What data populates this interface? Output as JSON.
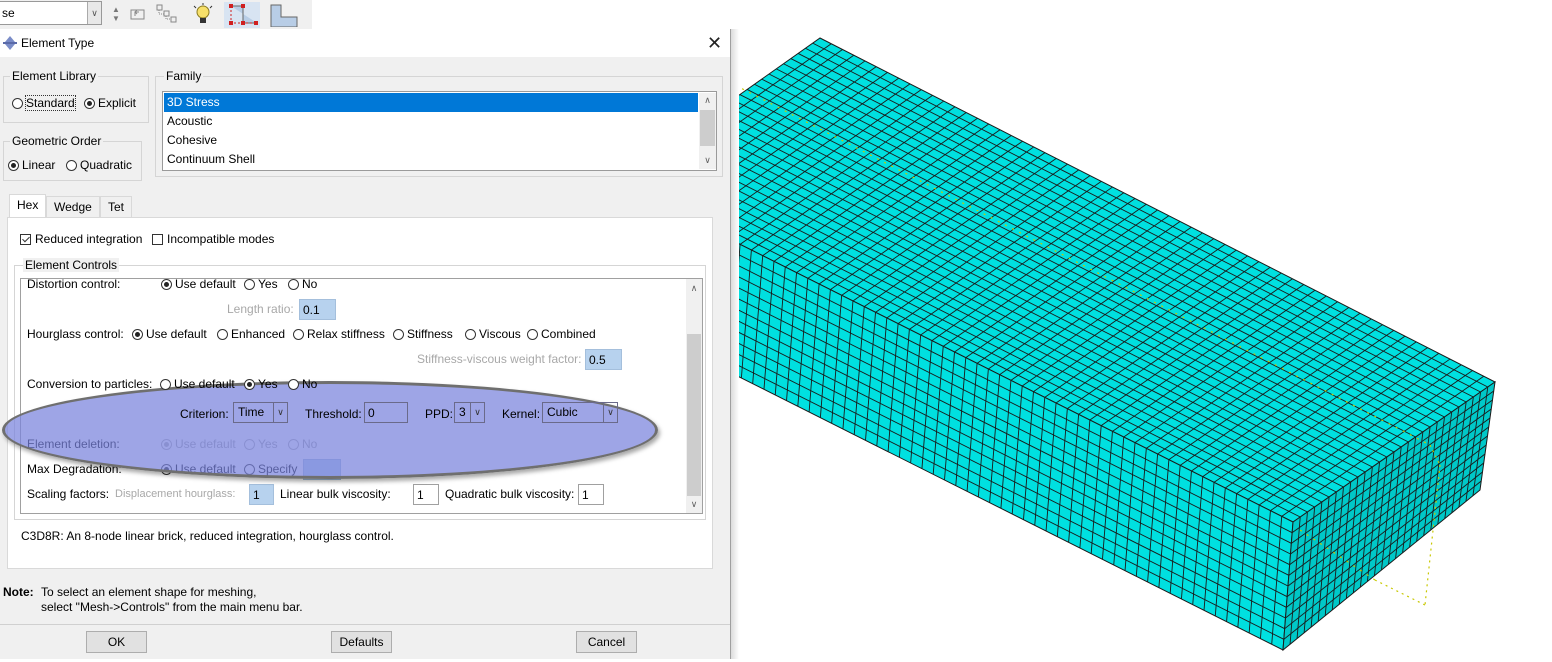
{
  "toolbar": {
    "combo_value": "se",
    "icons": [
      "spin-up-down-icon",
      "parent-folder-icon",
      "tree-nodes-icon",
      "lightbulb-icon",
      "sketch-corner-red-icon",
      "sketch-corner-icon"
    ]
  },
  "dialog": {
    "title": "Element Type",
    "icon": "element-type-icon",
    "element_library": {
      "label": "Element Library",
      "options": [
        "Standard",
        "Explicit"
      ],
      "selected": "Explicit"
    },
    "geometric_order": {
      "label": "Geometric Order",
      "options": [
        "Linear",
        "Quadratic"
      ],
      "selected": "Linear"
    },
    "family": {
      "label": "Family",
      "items": [
        "3D Stress",
        "Acoustic",
        "Cohesive",
        "Continuum Shell"
      ],
      "selected": "3D Stress"
    },
    "tabs": [
      {
        "label": "Hex",
        "active": true
      },
      {
        "label": "Wedge",
        "active": false
      },
      {
        "label": "Tet",
        "active": false
      }
    ],
    "reduced_integration": {
      "label": "Reduced integration",
      "checked": true
    },
    "incompatible_modes": {
      "label": "Incompatible modes",
      "checked": false
    },
    "element_controls": {
      "label": "Element Controls",
      "distortion_control": {
        "label": "Distortion control:",
        "options": [
          "Use default",
          "Yes",
          "No"
        ],
        "selected": "Use default",
        "length_ratio_label": "Length ratio:",
        "length_ratio": "0.1"
      },
      "hourglass_control": {
        "label": "Hourglass control:",
        "options": [
          "Use default",
          "Enhanced",
          "Relax stiffness",
          "Stiffness",
          "Viscous",
          "Combined"
        ],
        "selected": "Use default",
        "weight_factor_label": "Stiffness-viscous weight factor:",
        "weight_factor": "0.5"
      },
      "conversion_to_particles": {
        "label": "Conversion to particles:",
        "options": [
          "Use default",
          "Yes",
          "No"
        ],
        "selected": "Yes",
        "criterion_label": "Criterion:",
        "criterion": "Time",
        "threshold_label": "Threshold:",
        "threshold": "0",
        "ppd_label": "PPD:",
        "ppd": "3",
        "kernel_label": "Kernel:",
        "kernel": "Cubic"
      },
      "element_deletion": {
        "label": "Element deletion:",
        "options": [
          "Use default",
          "Yes",
          "No"
        ],
        "selected": "Use default",
        "disabled": true
      },
      "max_degradation": {
        "label": "Max Degradation:",
        "options": [
          "Use default",
          "Specify"
        ],
        "selected": "Use default",
        "value": ""
      },
      "scaling_factors": {
        "label": "Scaling factors:",
        "displacement_hourglass_label": "Displacement hourglass:",
        "displacement_hourglass": "1",
        "linear_bulk_label": "Linear bulk viscosity:",
        "linear_bulk": "1",
        "quadratic_bulk_label": "Quadratic bulk viscosity:",
        "quadratic_bulk": "1"
      }
    },
    "description": "C3D8R:  An 8-node linear brick, reduced integration, hourglass control.",
    "note_label": "Note:",
    "note_line1": "To select an element shape for meshing,",
    "note_line2": "select \"Mesh->Controls\" from the main menu bar.",
    "buttons": {
      "ok": "OK",
      "defaults": "Defaults",
      "cancel": "Cancel"
    }
  },
  "viewport": {
    "content": "meshed 3D rectangular block (hex elements)",
    "mesh_color": "#00e0e0",
    "mesh_side_color": "#00c8c8",
    "edge_color": "#1a1a1a",
    "construction_line_color": "#c8c800"
  }
}
